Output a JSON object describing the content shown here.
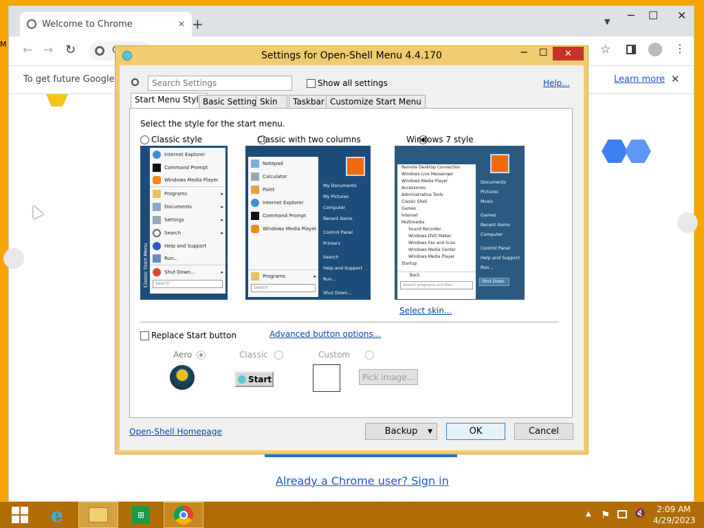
{
  "browser": {
    "tab_title": "Welcome to Chrome",
    "omnibox_text": "C",
    "infobar_text": "To get future Google Ch",
    "learn_more": "Learn more",
    "signin_link": "Already a Chrome user? Sign in",
    "side_text": "M"
  },
  "dialog": {
    "title": "Settings for Open-Shell Menu 4.4.170",
    "search_placeholder": "Search Settings",
    "show_all": "Show all settings",
    "help": "Help...",
    "tabs": [
      "Start Menu Style",
      "Basic Settings",
      "Skin",
      "Taskbar",
      "Customize Start Menu"
    ],
    "prompt": "Select the style for the start menu.",
    "styles": [
      "Classic style",
      "Classic with two columns",
      "Windows 7 style"
    ],
    "selected_style": "Windows 7 style",
    "select_skin": "Select skin...",
    "replace_start": "Replace Start button",
    "advanced": "Advanced button options...",
    "button_styles": [
      "Aero",
      "Classic",
      "Custom"
    ],
    "start_label": "Start",
    "pick_image": "Pick image...",
    "homepage": "Open-Shell Homepage",
    "backup": "Backup",
    "ok": "OK",
    "cancel": "Cancel"
  },
  "classic_preview": {
    "items": [
      "Internet Explorer",
      "Command Prompt",
      "Windows Media Player",
      "Programs",
      "Documents",
      "Settings",
      "Search",
      "Help and Support",
      "Run...",
      "Shut Down..."
    ],
    "sidebar": "Classic Start Menu",
    "search": "Search"
  },
  "twocol_preview": {
    "left": [
      "Notepad",
      "Calculator",
      "Paint",
      "Internet Explorer",
      "Command Prompt",
      "Windows Media Player"
    ],
    "programs": "Programs",
    "right": [
      "My Documents",
      "My Pictures",
      "Computer",
      "Recent Items",
      "Control Panel",
      "Printers",
      "Search",
      "Help and Support",
      "Run...",
      "Shut Down..."
    ],
    "search": "Search"
  },
  "w7_preview": {
    "left": [
      "Remote Desktop Connection",
      "Windows Live Messenger",
      "Windows Media Player",
      "Accessories",
      "Administrative Tools",
      "Classic Shell",
      "Games",
      "Internet",
      "Multimedia",
      "Sound Recorder",
      "Windows DVD Maker",
      "Windows Fax and Scan",
      "Windows Media Center",
      "Windows Media Player",
      "Startup"
    ],
    "back": "Back",
    "search": "Search programs and files",
    "right": [
      "Documents",
      "Pictures",
      "Music",
      "Games",
      "Recent Items",
      "Computer",
      "Control Panel",
      "Help and Support",
      "Run..."
    ],
    "shutdown": "Shut Down"
  },
  "taskbar": {
    "time": "2:09 AM",
    "date": "4/29/2023"
  },
  "colors": {
    "accent": "#f5a400",
    "panel": "#1c4c7a",
    "link": "#0645ad"
  }
}
